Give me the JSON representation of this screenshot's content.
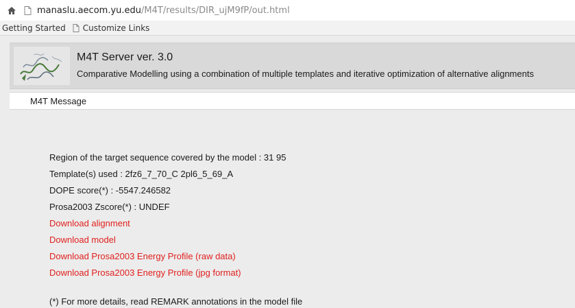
{
  "browser": {
    "url_host": "manaslu.aecom.yu.edu",
    "url_path": "/M4T/results/DIR_ujM9fP/out.html",
    "icons": {
      "home": "home-icon",
      "page": "page-icon"
    }
  },
  "bookmarks": {
    "items": [
      {
        "label": "Getting Started",
        "icon": "none"
      },
      {
        "label": "Customize Links",
        "icon": "page-icon"
      }
    ]
  },
  "header": {
    "title": "M4T Server ver. 3.0",
    "subtitle": "Comparative Modelling using a combination of multiple templates and iterative optimization of alternative alignments"
  },
  "message_bar": {
    "label": "M4T Message"
  },
  "results": {
    "region": "Region of the target sequence covered by the model : 31 95",
    "templates": "Template(s) used : 2fz6_7_70_C 2pl6_5_69_A",
    "dope": "DOPE score(*) : -5547.246582",
    "prosa": "Prosa2003 Zscore(*) : UNDEF",
    "links": {
      "alignment": "Download alignment",
      "model": "Download model",
      "profile_raw": "Download Prosa2003 Energy Profile (raw data)",
      "profile_jpg": "Download Prosa2003 Energy Profile (jpg format)"
    }
  },
  "footnote": "(*) For more details, read REMARK annotations in the model file",
  "colors": {
    "link": "#e0201e",
    "header_bg": "#d9d9d9",
    "page_bg": "#ececec"
  }
}
